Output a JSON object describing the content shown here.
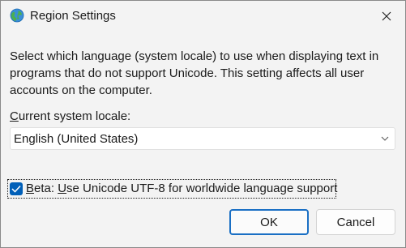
{
  "window": {
    "title": "Region Settings",
    "close_label": "✕",
    "icon": "globe-icon"
  },
  "description": "Select which language (system locale) to use when displaying text in programs that do not support Unicode. This setting affects all user accounts on the computer.",
  "locale": {
    "label_access_key": "C",
    "label_rest": "urrent system locale:",
    "selected": "English (United States)"
  },
  "beta_option": {
    "label_access_key": "B",
    "label_middle": "eta: ",
    "label_underlined": "U",
    "label_rest": "se Unicode UTF-8 for worldwide language support",
    "checked": true
  },
  "buttons": {
    "ok": "OK",
    "cancel": "Cancel"
  },
  "colors": {
    "accent": "#005fb8",
    "dialog_bg": "#f3f3f3",
    "focus_border": "#1a6fc4"
  }
}
